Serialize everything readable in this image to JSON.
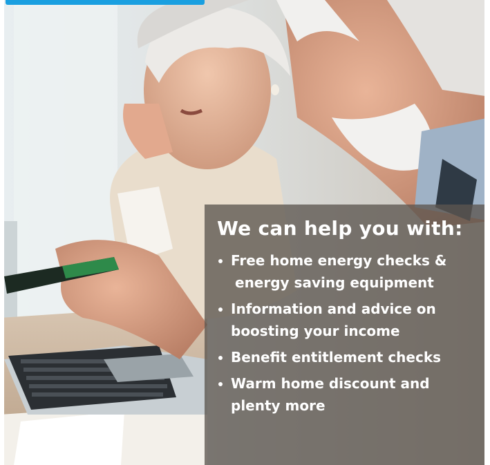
{
  "panel": {
    "title": "We can help you with:",
    "items": [
      {
        "line1": "Free home energy checks &",
        "line2": "energy saving equipment"
      },
      {
        "line1": "Information and advice on",
        "line2": "boosting your income"
      },
      {
        "line1": "Benefit entitlement checks",
        "line2": ""
      },
      {
        "line1": "Warm home discount and",
        "line2": "plenty more"
      }
    ]
  },
  "colors": {
    "accent": "#1a9fe0",
    "panel_overlay": "#5c5650",
    "panel_text": "#ffffff"
  },
  "photo": {
    "icon": "older-couple-at-laptop-photo"
  }
}
